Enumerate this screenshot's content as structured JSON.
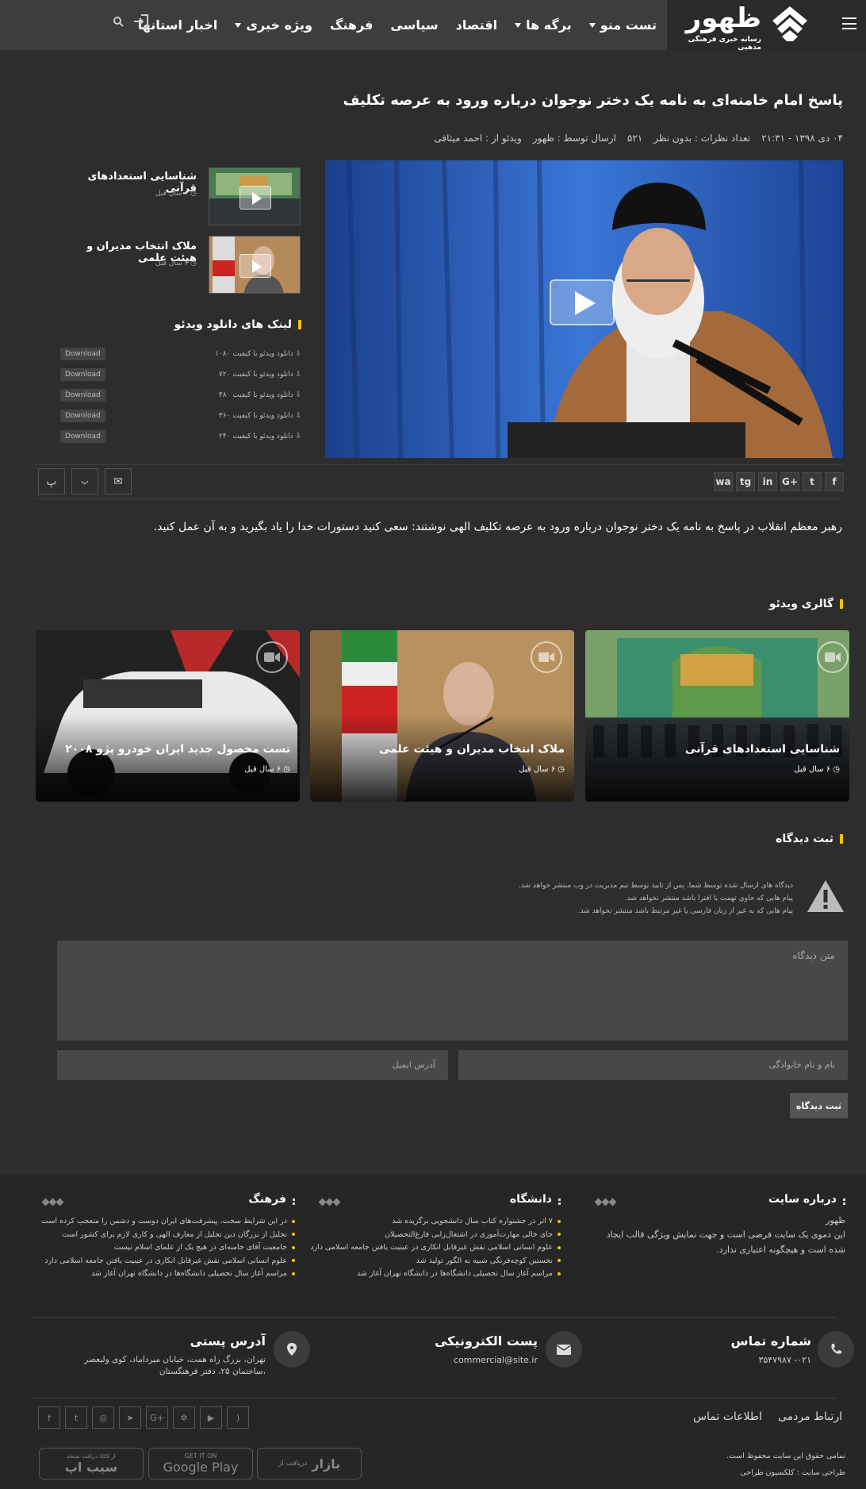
{
  "brand": {
    "name": "ظهور",
    "tagline": "رسانه خبری فرهنگی مذهبی"
  },
  "nav": [
    {
      "label": "تست منو",
      "has_dropdown": true
    },
    {
      "label": "برگه ها",
      "has_dropdown": true
    },
    {
      "label": "اقتصاد",
      "has_dropdown": false
    },
    {
      "label": "سیاسی",
      "has_dropdown": false
    },
    {
      "label": "فرهنگ",
      "has_dropdown": false
    },
    {
      "label": "ویژه خبری",
      "has_dropdown": true
    },
    {
      "label": "اخبار استانها",
      "has_dropdown": false
    }
  ],
  "article": {
    "title": "پاسخ امام خامنه‌ای به نامه یک دختر نوجوان درباره ورود به عرصه تکلیف",
    "date": "۰۴ دی ۱۳۹۸ - ۲۱:۳۱",
    "comments": "تعداد نظرات : بدون نظر",
    "views": "۵۲۱",
    "sender": "ارسال توسط : ظهور",
    "video_by": "ویدئو از : احمد میثاقی",
    "description": "رهبر معظم انقلاب در پاسخ به نامه یک دختر نوجوان درباره ورود به عرصه تکلیف الهی نوشتند: سعی کنید دستورات خدا را یاد بگیرید و به آن عمل کنید."
  },
  "related": [
    {
      "title": "شناسایی استعدادهای قرآنی",
      "ago": "۶ سال قبل"
    },
    {
      "title": "ملاک انتخاب مدیران و هیئت علمی",
      "ago": "۶ سال قبل"
    }
  ],
  "downloads": {
    "heading": "لینک های دانلود ویدئو",
    "button": "Download",
    "items": [
      "دانلود ویدئو با کیفیت ۱۰۸۰",
      "دانلود ویدئو با کیفیت ۷۲۰",
      "دانلود ویدئو با کیفیت ۴۸۰",
      "دانلود ویدئو با کیفیت ۳۶۰",
      "دانلود ویدئو با کیفیت ۲۴۰"
    ]
  },
  "share": [
    "f",
    "t",
    "G+",
    "in",
    "tg",
    "wa"
  ],
  "tools": {
    "print": "پ",
    "font": "پ"
  },
  "gallery": {
    "heading": "گالری ویدئو",
    "items": [
      {
        "title": "شناسایی استعدادهای قرآنی",
        "ago": "۶ سال قبل"
      },
      {
        "title": "ملاک انتخاب مدیران و هیئت علمی",
        "ago": "۶ سال قبل"
      },
      {
        "title": "تست محصول جدید ایران خودرو پژو ۲۰۰۸",
        "ago": "۶ سال قبل"
      }
    ]
  },
  "comment": {
    "heading": "ثبت دیدگاه",
    "rules": [
      "دیدگاه های ارسال شده توسط شما، پس از تایید توسط تیم مدیریت در وب منتشر خواهد شد.",
      "پیام هایی که حاوی تهمت یا افترا باشد منتشر نخواهد شد.",
      "پیام هایی که به غیر از زبان فارسی یا غیر مرتبط باشد منتشر نخواهد شد."
    ],
    "text_placeholder": "متن دیدگاه",
    "name_placeholder": "نام و نام خانوادگی",
    "email_placeholder": "آدرس ایمیل",
    "submit": "ثبت دیدگاه"
  },
  "footer": {
    "about": {
      "heading": "درباره سایت",
      "name": "ظهور",
      "text": "این دموی یک سایت فرضی است و جهت نمایش ویژگی قالب ایجاد شده است و هیچگونه اعتباری ندارد."
    },
    "university": {
      "heading": "دانشگاه",
      "items": [
        "۷ اثر در جشنواره کتاب سال دانشجویی برگزیده شد",
        "جای خالی مهارت‌آموزی در اشتغال‌زایی فارغ‌التحصیلان",
        "علوم انسانی اسلامی نقش غیرقابل انکاری در عینیت یافتن جامعه اسلامی دارد",
        "نخستین کوچه‌فرنگی شبیه به الگور تولید شد",
        "مراسم آغاز سال تحصیلی دانشگاه‌ها در دانشگاه تهران آغاز شد"
      ]
    },
    "culture": {
      "heading": "فرهنگ",
      "items": [
        "در این شرایط سخت، پیشرفت‌های ایران دوست و دشمن را متعجب کرده است",
        "تجلیل از بزرگان دین تجلیل از معارف الهی و کاری لازم برای کشور است",
        "جامعیت آقای خامنه‌ای در هیچ یک از علمای اسلام نیست",
        "علوم انسانی اسلامی نقش غیرقابل انکاری در عینیت یافتن جامعه اسلامی دارد",
        "مراسم آغاز سال تحصیلی دانشگاه‌ها در دانشگاه تهران آغاز شد"
      ]
    },
    "contact": {
      "phone_label": "شماره تماس",
      "phone": "۰۲۱- ۳۵۴۷۹۸۷",
      "email_label": "پست الکترونیکی",
      "email": "commercial@site.ir",
      "address_label": "آدرس پستی",
      "address": "تهران، بزرگ راه همت، خیابان میرداماد، کوی ولیعصر ،ساختمان ۲۵، دفتر فرهنگستان"
    },
    "links": [
      "ارتباط مردمی",
      "اطلاعات تماس"
    ],
    "copyright": "تمامی حقوق این سایت محفوظ است.",
    "designer": "طراحی سایت : کلکسیون طراحی",
    "stores": [
      {
        "top": "دریافت از",
        "name": "بازار"
      },
      {
        "top": "GET IT ON",
        "name": "Google Play"
      },
      {
        "top": "دریافت نسخه iOS از",
        "name": "سیب اپ"
      }
    ]
  },
  "colors": {
    "accent": "#f3c10f",
    "bg": "#2d2d2d",
    "header": "#3d3d3d"
  }
}
